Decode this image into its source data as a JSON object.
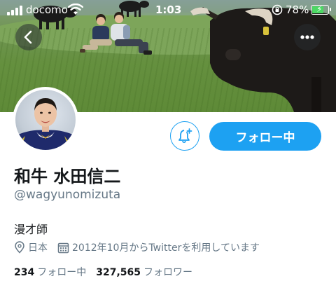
{
  "status_bar": {
    "carrier": "docomo",
    "time": "1:03",
    "battery_percent": "78%",
    "battery_level": 0.78,
    "battery_color": "#4cd964"
  },
  "header": {
    "back_icon": "chevron-left-icon",
    "more_icon": "more-horizontal-icon"
  },
  "profile": {
    "display_name": "和牛 水田信二",
    "handle": "@wagyunomizuta",
    "bio": "漫才師",
    "location": "日本",
    "joined": "2012年10月からTwitterを利用しています",
    "following_count": "234",
    "following_label": "フォロー中",
    "followers_count": "327,565",
    "followers_label": "フォロワー"
  },
  "actions": {
    "notify_icon": "bell-plus-icon",
    "follow_button_label": "フォロー中",
    "accent_color": "#1da1f2"
  }
}
